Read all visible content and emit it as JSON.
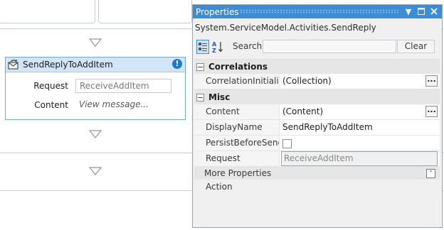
{
  "designer": {
    "activity": {
      "title": "SendReplyToAddItem",
      "warning_glyph": "!",
      "request_label": "Request",
      "request_value": "ReceiveAddItem",
      "content_label": "Content",
      "content_value": "View message..."
    },
    "icons": [
      "drop-arrow-icon",
      "send-reply-icon",
      "warning-icon"
    ]
  },
  "properties": {
    "window_title": "Properties",
    "type_name": "System.ServiceModel.Activities.SendReply",
    "search_label": "Search:",
    "search_value": "",
    "clear_label": "Clear",
    "categories": [
      {
        "name": "Correlations",
        "rows": [
          {
            "name": "CorrelationInitializ...",
            "value": "(Collection)"
          }
        ]
      },
      {
        "name": "Misc",
        "rows": [
          {
            "name": "Content",
            "value": "(Content)"
          },
          {
            "name": "DisplayName",
            "value": "SendReplyToAddItem"
          },
          {
            "name": "PersistBeforeSend",
            "value": ""
          },
          {
            "name": "Request",
            "value": "ReceiveAddItem"
          }
        ]
      }
    ],
    "more_properties_label": "More Properties",
    "more_rows": [
      {
        "name": "Action",
        "value": ""
      }
    ],
    "persist_before_send_checked": false,
    "accent_color": "#3d8cd6"
  }
}
